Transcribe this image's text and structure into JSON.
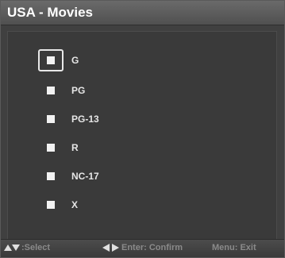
{
  "title": "USA - Movies",
  "items": [
    {
      "label": "G",
      "focused": true
    },
    {
      "label": "PG",
      "focused": false
    },
    {
      "label": "PG-13",
      "focused": false
    },
    {
      "label": "R",
      "focused": false
    },
    {
      "label": "NC-17",
      "focused": false
    },
    {
      "label": "X",
      "focused": false
    }
  ],
  "footer": {
    "select_hint": ":Select",
    "confirm_hint": "Enter: Confirm",
    "exit_hint": "Menu: Exit"
  }
}
